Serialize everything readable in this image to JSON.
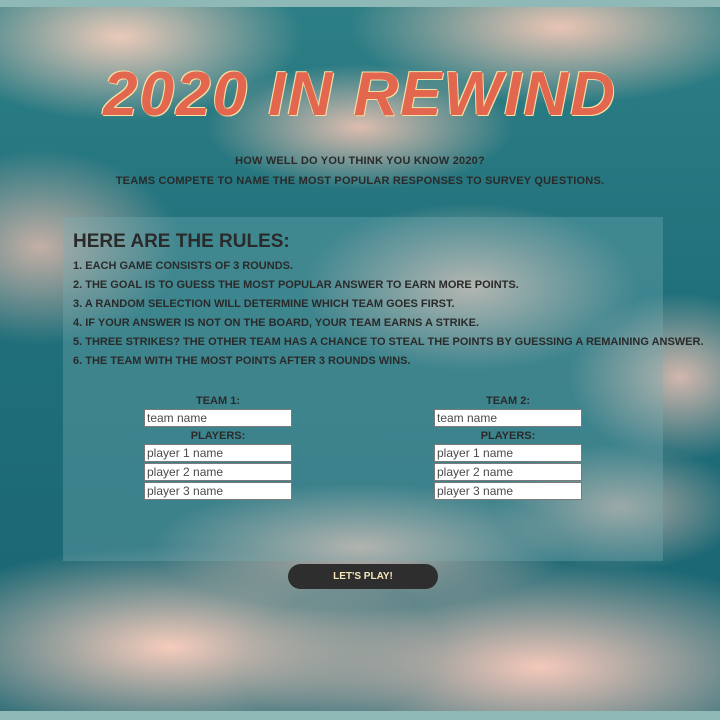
{
  "header": {
    "title": "2020 IN REWIND",
    "subtitle_line1": "HOW WELL DO YOU THINK YOU KNOW 2020?",
    "subtitle_line2": "TEAMS COMPETE TO NAME THE MOST POPULAR RESPONSES TO SURVEY QUESTIONS."
  },
  "rules": {
    "heading": "HERE ARE THE RULES:",
    "items": [
      "1. EACH GAME CONSISTS OF 3 ROUNDS.",
      "2. THE GOAL IS TO GUESS THE MOST POPULAR ANSWER TO EARN MORE POINTS.",
      "3. A RANDOM SELECTION WILL DETERMINE WHICH TEAM GOES FIRST.",
      "4. IF YOUR ANSWER IS NOT ON THE BOARD, YOUR TEAM EARNS A STRIKE.",
      "5. THREE STRIKES? THE OTHER TEAM HAS A CHANCE TO STEAL THE POINTS BY GUESSING A REMAINING ANSWER.",
      "6. THE TEAM WITH THE MOST POINTS AFTER 3 ROUNDS WINS."
    ]
  },
  "teams": [
    {
      "label": "TEAM 1:",
      "team_placeholder": "team name",
      "players_label": "PLAYERS:",
      "player_placeholders": [
        "player 1 name",
        "player 2 name",
        "player 3 name"
      ]
    },
    {
      "label": "TEAM 2:",
      "team_placeholder": "team name",
      "players_label": "PLAYERS:",
      "player_placeholders": [
        "player 1 name",
        "player 2 name",
        "player 3 name"
      ]
    }
  ],
  "actions": {
    "play_label": "LET'S PLAY!"
  },
  "colors": {
    "title": "#e3664f",
    "title_outline": "#f5e0a6",
    "button_bg": "#2e2e2e",
    "button_text": "#f4e6b8"
  }
}
